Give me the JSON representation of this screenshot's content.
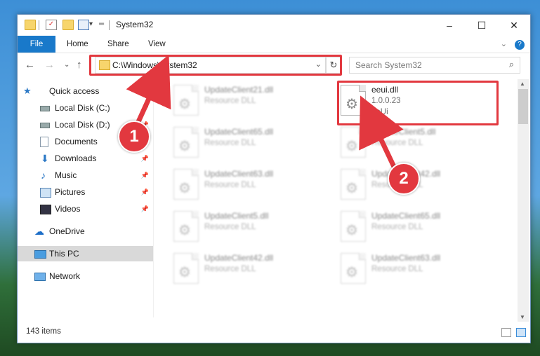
{
  "title_bar": {
    "title": "System32",
    "controls": [
      "–",
      "☐",
      "✕"
    ]
  },
  "ribbon": {
    "tabs": [
      "File",
      "Home",
      "Share",
      "View"
    ],
    "help": "?"
  },
  "nav": {
    "address": "C:\\Windows\\System32",
    "search_placeholder": "Search System32",
    "icons": [
      "back-arrow-icon",
      "forward-arrow-icon",
      "recent-chevron-icon",
      "up-arrow-icon",
      "refresh-icon",
      "search-icon"
    ]
  },
  "sidebar": {
    "items": [
      {
        "label": "Quick access",
        "icon": "star-icon",
        "pinned": false
      },
      {
        "label": "Local Disk (C:)",
        "icon": "drive-icon",
        "pinned": false
      },
      {
        "label": "Local Disk (D:)",
        "icon": "drive-icon",
        "pinned": false
      },
      {
        "label": "Documents",
        "icon": "documents-icon",
        "pinned": false
      },
      {
        "label": "Downloads",
        "icon": "download-icon",
        "pinned": true
      },
      {
        "label": "Music",
        "icon": "music-icon",
        "pinned": true
      },
      {
        "label": "Pictures",
        "icon": "pictures-icon",
        "pinned": true
      },
      {
        "label": "Videos",
        "icon": "videos-icon",
        "pinned": true
      },
      {
        "label": "OneDrive",
        "icon": "cloud-icon",
        "pinned": false
      },
      {
        "label": "This PC",
        "icon": "computer-icon",
        "pinned": false,
        "selected": true
      },
      {
        "label": "Network",
        "icon": "network-icon",
        "pinned": false
      }
    ]
  },
  "files": [
    {
      "name": "UpdateClient21.dll",
      "desc": "Resource DLL"
    },
    {
      "name": "eeui.dll",
      "desc": "1.0.0.23",
      "extra": "eeUi"
    },
    {
      "name": "UpdateClient65.dll",
      "desc": "Resource DLL"
    },
    {
      "name": "UpdateClient5.dll",
      "desc": "Resource DLL"
    },
    {
      "name": "UpdateClient63.dll",
      "desc": "Resource DLL"
    },
    {
      "name": "UpdateClient42.dll",
      "desc": "Resource DLL"
    },
    {
      "name": "UpdateClient5.dll",
      "desc": "Resource DLL"
    },
    {
      "name": "UpdateClient65.dll",
      "desc": "Resource DLL"
    },
    {
      "name": "UpdateClient42.dll",
      "desc": "Resource DLL"
    },
    {
      "name": "UpdateClient63.dll",
      "desc": "Resource DLL"
    }
  ],
  "status": {
    "item_count": "143 items"
  },
  "annotations": {
    "step1": "1",
    "step2": "2",
    "color": "#e2383f"
  }
}
